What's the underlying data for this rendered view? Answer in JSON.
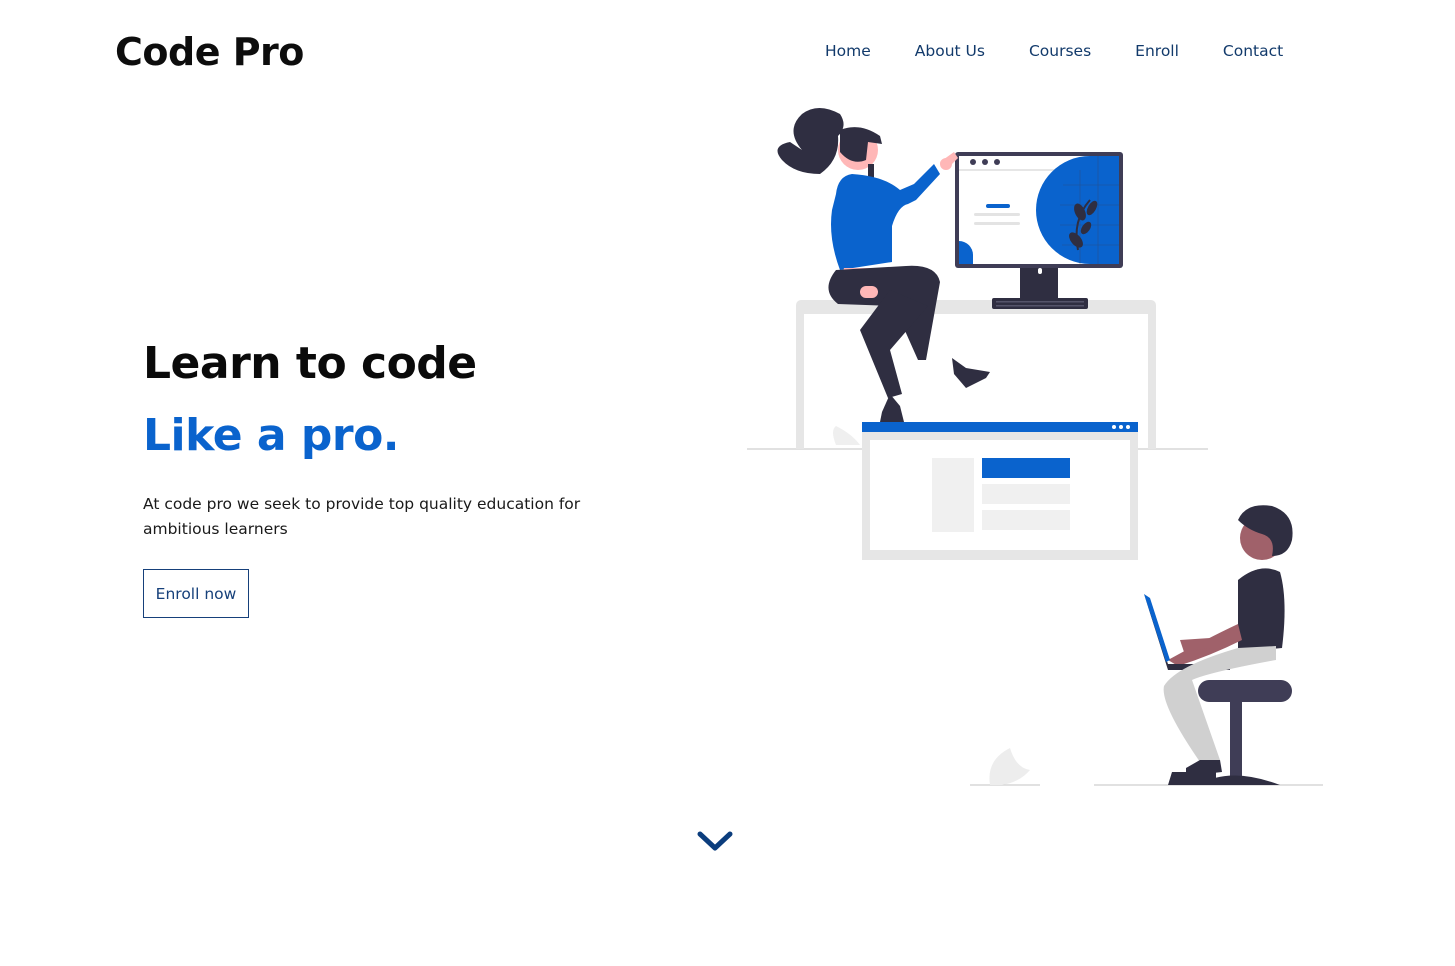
{
  "header": {
    "logo": "Code Pro",
    "nav": [
      {
        "label": "Home"
      },
      {
        "label": "About Us"
      },
      {
        "label": "Courses"
      },
      {
        "label": "Enroll"
      },
      {
        "label": "Contact"
      }
    ]
  },
  "hero": {
    "title": "Learn to code",
    "accent": "Like a pro.",
    "description": "At code pro we seek to provide top quality education for ambitious learners",
    "cta_label": "Enroll now"
  },
  "illustration": {
    "name": "people-coding-illustration"
  },
  "scroll": {
    "icon": "chevron-down-icon"
  },
  "colors": {
    "accent": "#0a63cd",
    "nav_text": "#123a6b",
    "dark": "#2f2e41",
    "light_gray": "#e6e6e6"
  }
}
